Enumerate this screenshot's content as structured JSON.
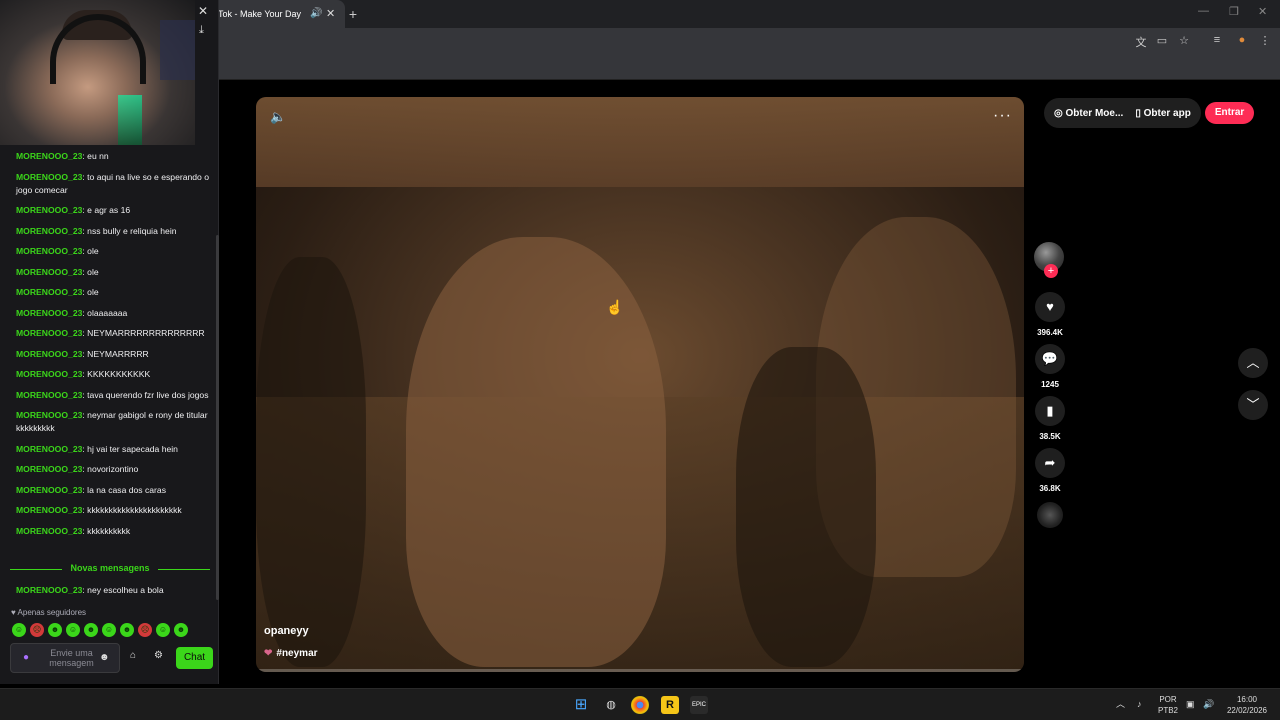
{
  "browser": {
    "tab_title": "Tok - Make Your Day",
    "tab_speaker": "🔊",
    "tab_close": "✕",
    "new_tab": "+",
    "toolbar_icons": [
      "translate-icon",
      "cast-icon",
      "star-icon",
      "media-icon",
      "profile-icon",
      "menu-icon"
    ]
  },
  "video": {
    "author": "opaneyy",
    "hashtag": "#neymar",
    "more": "···"
  },
  "top_bar": {
    "coins_label": "Obter Moe...",
    "app_label": "Obter app",
    "enter_label": "Entrar"
  },
  "actions": {
    "likes": "396.4K",
    "comments": "1245",
    "saves": "38.5K",
    "shares": "36.8K"
  },
  "chat": {
    "messages": [
      {
        "user": "MORENOOO_23",
        "text": "eu nn"
      },
      {
        "user": "MORENOOO_23",
        "text": "to aqui na live so e esperando o jogo comecar"
      },
      {
        "user": "MORENOOO_23",
        "text": "e agr as 16"
      },
      {
        "user": "MORENOOO_23",
        "text": "nss bully e reliquia hein"
      },
      {
        "user": "MORENOOO_23",
        "text": "ole"
      },
      {
        "user": "MORENOOO_23",
        "text": "ole"
      },
      {
        "user": "MORENOOO_23",
        "text": "ole"
      },
      {
        "user": "MORENOOO_23",
        "text": "olaaaaaaa"
      },
      {
        "user": "MORENOOO_23",
        "text": "NEYMARRRRRRRRRRRRRR"
      },
      {
        "user": "MORENOOO_23",
        "text": "NEYMARRRRR"
      },
      {
        "user": "MORENOOO_23",
        "text": "KKKKKKKKKKK"
      },
      {
        "user": "MORENOOO_23",
        "text": "tava querendo fzr live dos jogos"
      },
      {
        "user": "MORENOOO_23",
        "text": "neymar gabigol e rony de titular kkkkkkkkk"
      },
      {
        "user": "MORENOOO_23",
        "text": "hj vai ter sapecada hein"
      },
      {
        "user": "MORENOOO_23",
        "text": "novorizontino"
      },
      {
        "user": "MORENOOO_23",
        "text": "la na casa dos caras"
      },
      {
        "user": "MORENOOO_23",
        "text": "kkkkkkkkkkkkkkkkkkkkkk"
      },
      {
        "user": "MORENOOO_23",
        "text": "kkkkkkkkkk"
      }
    ],
    "new_messages_label": "Novas mensagens",
    "new_message": {
      "user": "MORENOOO_23",
      "text": "ney escolheu a bola"
    },
    "followers_only": "Apenas seguidores",
    "input_placeholder": "Envie uma mensagem",
    "chat_button": "Chat"
  },
  "taskbar": {
    "lang_top": "POR",
    "lang_bottom": "PTB2",
    "time": "16:00",
    "date": "22/02/2026"
  },
  "colors": {
    "accent_tiktok": "#fe2c55",
    "chat_user": "#3bd61a"
  }
}
